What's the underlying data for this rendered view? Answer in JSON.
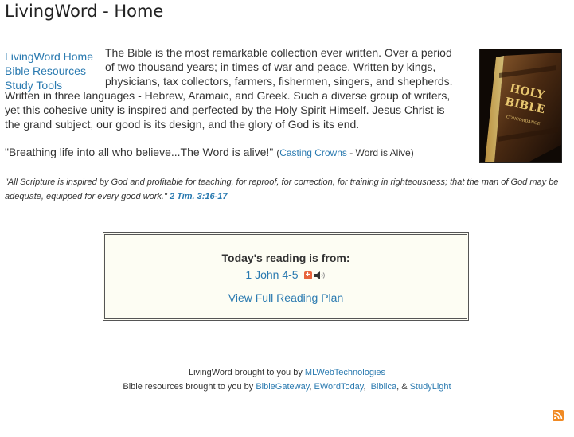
{
  "page": {
    "title": "LivingWord - Home"
  },
  "nav": {
    "items": [
      {
        "label": "LivingWord Home"
      },
      {
        "label": "Bible Resources"
      },
      {
        "label": "Study Tools"
      }
    ]
  },
  "intro": {
    "text": "The Bible is the most remarkable collection ever written. Over a period of two thousand years; in times of war and peace. Written by kings, physicians, tax collectors, farmers, fishermen, singers, and shepherds. Written in three languages - Hebrew, Aramaic, and Greek. Such a diverse group of writers, yet this cohesive unity is inspired and perfected by the Holy Spirit Himself. Jesus Christ is the grand subject, our good is its design, and the glory of God is its end."
  },
  "image": {
    "text": [
      "HOLY",
      "BIBLE"
    ],
    "subtext": "CONCORDANCE"
  },
  "quote": {
    "text": "\"Breathing life into all who believe...The Word is alive!\"",
    "open_paren": "(",
    "artist": "Casting Crowns",
    "song": " - Word is Alive)"
  },
  "scripture": {
    "text": "\"All Scripture is inspired by God and profitable for teaching, for reproof, for correction, for training in righteousness; that the man of God may be adequate, equipped for every good work.\"",
    "reference": "2 Tim. 3:16-17"
  },
  "reading": {
    "title": "Today's reading is from:",
    "passage": "1 John 4-5",
    "plan_link": "View Full Reading Plan"
  },
  "footer": {
    "line1_prefix": "LivingWord brought to you by ",
    "line1_link": "MLWebTechnologies",
    "line2_prefix": "Bible resources brought to you by ",
    "links": [
      "BibleGateway",
      "EWordToday",
      "Biblica",
      "StudyLight"
    ],
    "sep1": ", ",
    "sep2": ",  ",
    "sep3": ", & "
  },
  "colors": {
    "link": "#2a7ab0",
    "box_background": "#fdfdf3",
    "rss": "#f08a24"
  },
  "icons": [
    "plus-icon",
    "speaker-icon",
    "rss-icon"
  ]
}
